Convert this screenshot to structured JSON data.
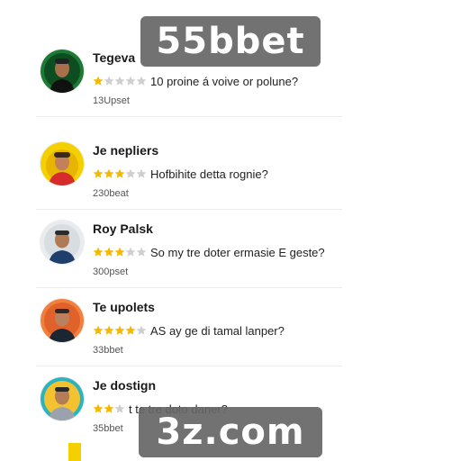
{
  "colors": {
    "star_filled": "#f5b800",
    "star_empty": "#cfcfcf",
    "watermark_bg": "#666666",
    "accent_yellow": "#f5d000"
  },
  "watermarks": {
    "top": "55bbet",
    "bottom": "3z.com"
  },
  "reviews": [
    {
      "name": "Tegeva",
      "stars_filled": 1,
      "stars_total": 5,
      "question": "10 proine á voive or polune?",
      "meta": "13Upset",
      "avatar_icon": "man-avatar-icon"
    },
    {
      "name": "Je nepliers",
      "stars_filled": 3,
      "stars_total": 5,
      "question": "Hofbihite detta rognie?",
      "meta": "230beat",
      "avatar_icon": "man-avatar-icon"
    },
    {
      "name": "Roy Palsk",
      "stars_filled": 3,
      "stars_total": 5,
      "question": "So my tre doter ermasie E geste?",
      "meta": "300pset",
      "avatar_icon": "man-avatar-icon"
    },
    {
      "name": "Te upolets",
      "stars_filled": 4,
      "stars_total": 5,
      "question": "AS ay ge di tamal lanper?",
      "meta": "33bbet",
      "avatar_icon": "man-avatar-icon"
    },
    {
      "name": "Je dostign",
      "stars_filled": 2,
      "stars_total": 3,
      "question": "t te tre doto daner?",
      "meta": "35bbet",
      "avatar_icon": "man-avatar-icon"
    }
  ]
}
